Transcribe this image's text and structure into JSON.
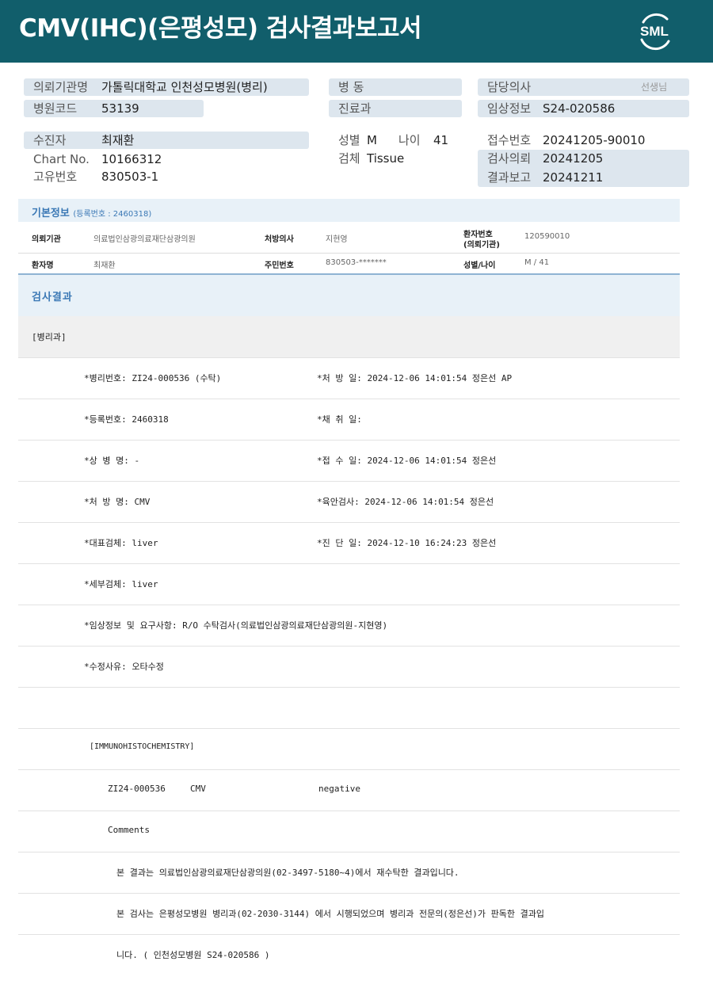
{
  "header": {
    "title": "CMV(IHC)(은평성모) 검사결과보고서",
    "logo_text": "SML"
  },
  "top": {
    "ordering_hospital_label": "의뢰기관명",
    "ordering_hospital": "가톨릭대학교 인천성모병원(병리)",
    "hospital_code_label": "병원코드",
    "hospital_code": "53139",
    "ward_label": "병 동",
    "ward": "",
    "department_label": "진료과",
    "department": "",
    "doctor_label": "담당의사",
    "doctor_suffix": "선생님",
    "clinical_info_label": "임상정보",
    "clinical_info": "S24-020586",
    "patient_label": "수진자",
    "patient": "최재환",
    "chart_label": "Chart No.",
    "chart_no": "10166312",
    "unique_label": "고유번호",
    "unique_no": "830503-1",
    "sex_label": "성별",
    "sex": "M",
    "age_label": "나이",
    "age": "41",
    "specimen_label": "검체",
    "specimen": "Tissue",
    "receipt_label": "접수번호",
    "receipt_no": "20241205-90010",
    "request_label": "검사의뢰",
    "request_date": "20241205",
    "report_label": "결과보고",
    "report_date": "20241211"
  },
  "basic_info": {
    "title": "기본정보",
    "reg_note": "(등록번호 : 2460318)",
    "institution_label": "의뢰기관",
    "institution": "의료법인삼광의료재단삼광의원",
    "prescriber_label": "처방의사",
    "prescriber": "지현영",
    "patient_no_label_1": "환자번호",
    "patient_no_label_2": "(의뢰기관)",
    "patient_no": "120590010",
    "patient_name_label": "환자명",
    "patient_name": "최재환",
    "rrn_label": "주민번호",
    "rrn": "830503-*******",
    "sex_age_label": "성별/나이",
    "sex_age": "M / 41"
  },
  "results": {
    "title": "검사결과",
    "dept": "[병리과]",
    "rows": [
      {
        "left": "*병리번호: ZI24-000536 (수탁)",
        "right": "*처 방 일: 2024-12-06 14:01:54  정은선 AP"
      },
      {
        "left": "*등록번호: 2460318",
        "right": "*채 취 일:"
      },
      {
        "left": "*상 병 명: -",
        "right": "*접 수 일: 2024-12-06 14:01:54  정은선"
      },
      {
        "left": "*처 방 명: CMV",
        "right": "*육안검사: 2024-12-06 14:01:54  정은선"
      },
      {
        "left": "*대표검체: liver",
        "right": "*진 단 일: 2024-12-10 16:24:23  정은선"
      },
      {
        "left": "*세부검체: liver",
        "right": ""
      },
      {
        "left": "*임상정보 및 요구사항: R/O 수탁검사(의료법인삼광의료재단삼광의원-지현영)",
        "right": ""
      },
      {
        "left": "*수정사유: 오타수정",
        "right": ""
      }
    ],
    "ihc_title": "[IMMUNOHISTOCHEMISTRY]",
    "ihc_id": "ZI24-000536",
    "ihc_marker": "CMV",
    "ihc_result": "negative",
    "comments_label": "Comments",
    "comment_1": "본 결과는 의료법인삼광의료재단삼광의원(02-3497-5180~4)에서 재수탁한 결과입니다.",
    "comment_2": "본 검사는 은평성모병원 병리과(02-2030-3144) 에서 시행되었으며 병리과 전문의(정은선)가 판독한 결과입",
    "comment_3": "니다. ( 인천성모병원 S24-020586 )"
  },
  "colors": {
    "header_bg": "#115e6b",
    "label_bg": "#dde6ee",
    "section_bg": "#e8f1f8",
    "section_title": "#3a78b5",
    "dept_bg": "#f0f0f0"
  }
}
